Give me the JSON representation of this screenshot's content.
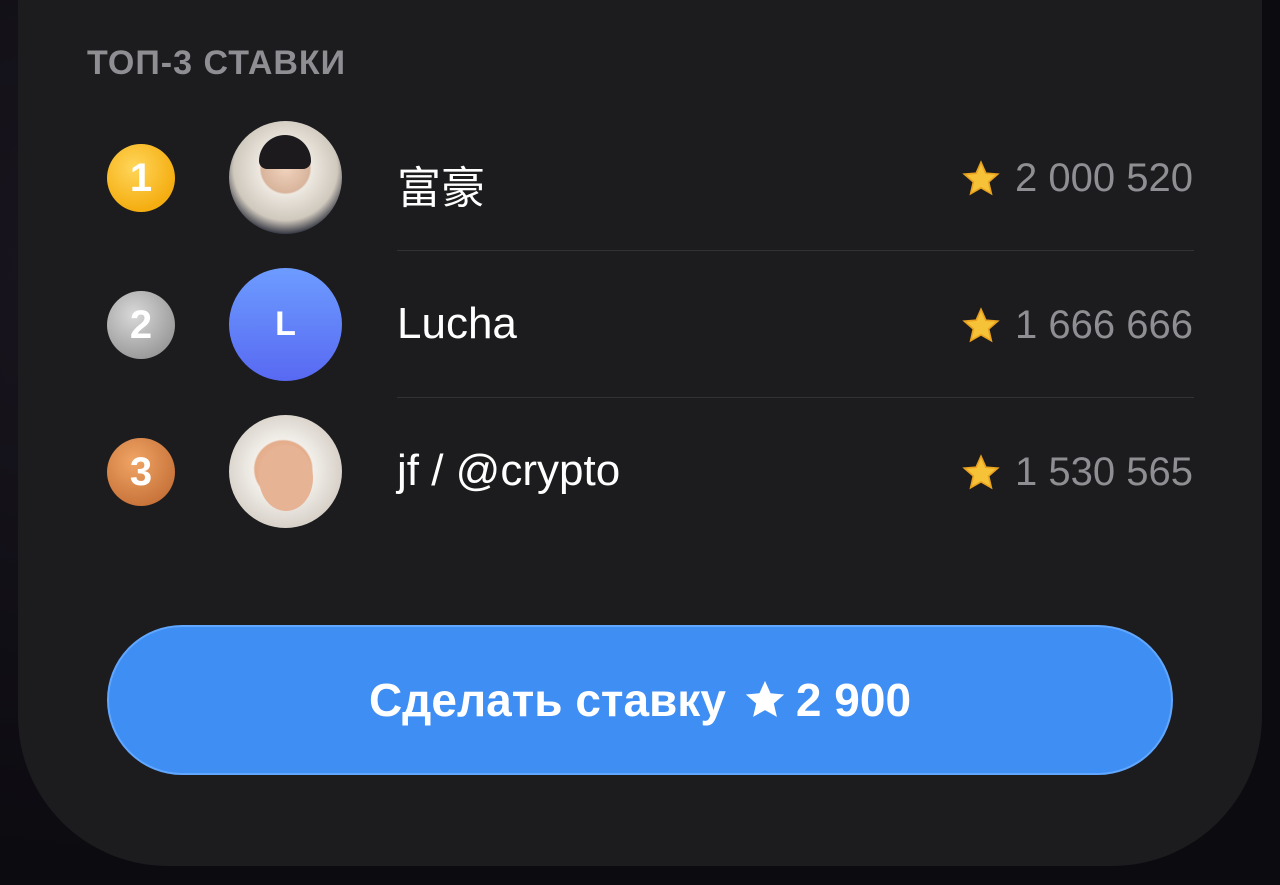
{
  "section_title": "ТОП-3 СТАВКИ",
  "leaderboard": [
    {
      "rank": "1",
      "name": "富豪",
      "amount": "2 000 520",
      "avatar": "photo",
      "medal_color": "#f5ae12"
    },
    {
      "rank": "2",
      "name": "Lucha",
      "amount": "1 666 666",
      "avatar": "letter",
      "avatar_letter": "L",
      "medal_color": "#9a9a9a"
    },
    {
      "rank": "3",
      "name": "jf / @crypto",
      "amount": "1 530 565",
      "avatar": "photo",
      "medal_color": "#c8733a"
    }
  ],
  "cta": {
    "label": "Сделать ставку",
    "amount": "2 900",
    "icon": "star-icon",
    "color": "#3e8ef3"
  },
  "icons": {
    "amount_icon": "star-icon"
  }
}
